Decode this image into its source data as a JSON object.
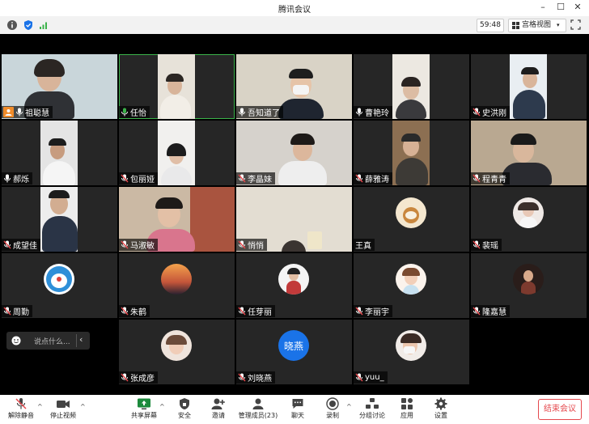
{
  "window": {
    "title": "腾讯会议"
  },
  "infobar": {
    "time": "59:48",
    "view_label": "宫格视图"
  },
  "participants": [
    {
      "name": "祖聪慧",
      "host": true,
      "muted": false
    },
    {
      "name": "任怡",
      "host": false,
      "muted": false
    },
    {
      "name": "吾知道了",
      "host": false,
      "muted": false
    },
    {
      "name": "曹艳玲",
      "host": false,
      "muted": false
    },
    {
      "name": "史洪刚",
      "host": false,
      "muted": true
    },
    {
      "name": "郝烁",
      "host": false,
      "muted": false
    },
    {
      "name": "包丽娅",
      "host": false,
      "muted": true
    },
    {
      "name": "李晶妹",
      "host": false,
      "muted": true
    },
    {
      "name": "薛雅涛",
      "host": false,
      "muted": true
    },
    {
      "name": "程青青",
      "host": false,
      "muted": true
    },
    {
      "name": "成望佳",
      "host": false,
      "muted": true
    },
    {
      "name": "马淑敏",
      "host": false,
      "muted": true
    },
    {
      "name": "悄悄",
      "host": false,
      "muted": true
    },
    {
      "name": "王真",
      "host": false,
      "muted": false
    },
    {
      "name": "裴瑶",
      "host": false,
      "muted": true
    },
    {
      "name": "周勤",
      "host": false,
      "muted": true
    },
    {
      "name": "朱鹤",
      "host": false,
      "muted": true
    },
    {
      "name": "任芽丽",
      "host": false,
      "muted": true
    },
    {
      "name": "李丽宇",
      "host": false,
      "muted": true
    },
    {
      "name": "隆嘉慧",
      "host": false,
      "muted": true
    },
    {
      "name": "张成彦",
      "host": false,
      "muted": true
    },
    {
      "name": "刘晓燕",
      "host": false,
      "muted": true,
      "avatar_text": "晓燕"
    },
    {
      "name": "yuu_",
      "host": false,
      "muted": true
    }
  ],
  "chat": {
    "placeholder": "说点什么..."
  },
  "toolbar": {
    "unmute": "解除静音",
    "stop_video": "停止视频",
    "share_screen": "共享屏幕",
    "security": "安全",
    "invite": "邀请",
    "manage_members": "管理成员(23)",
    "chat": "聊天",
    "record": "录制",
    "breakout": "分组讨论",
    "apps": "应用",
    "settings": "设置",
    "end_meeting": "结束会议"
  },
  "colors": {
    "accent": "#3bb34a",
    "end": "#e5484d",
    "host_badge": "#f08c2a",
    "avatar_blue": "#1a73e8"
  }
}
